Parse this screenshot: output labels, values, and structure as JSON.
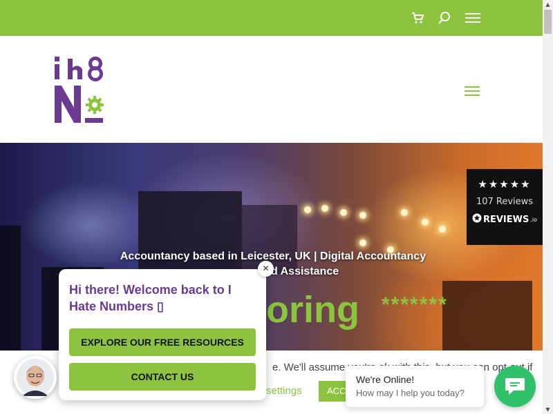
{
  "topbar": {
    "icons": [
      "cart-icon",
      "search-icon",
      "menu-icon"
    ]
  },
  "colors": {
    "brand_green": "#8cc440",
    "brand_purple": "#6b3a92",
    "chat_green": "#2fc26b"
  },
  "logo": {
    "line1": "i h8",
    "line2": "N"
  },
  "hero": {
    "tagline": "Accountancy based in Leicester, UK | Digital Accountancy",
    "tagline2_partial": "d Assistance",
    "headline_partial": "oring",
    "stars": "*******"
  },
  "reviews_badge": {
    "stars": "★★★★★",
    "count_label": "107 Reviews",
    "brand": "REVIEWS",
    "brand_suffix": ".io"
  },
  "cookie_bar": {
    "text_partial": "e. We'll assume you're ok with this, but you can opt-out if",
    "settings_label": "settings",
    "accept_label": "ACCEPT"
  },
  "welcome_popup": {
    "message": "Hi there! Welcome back to I Hate Numbers ",
    "message_glyph": "▯",
    "buttons": {
      "explore": "EXPLORE OUR FREE RESOURCES",
      "contact": "CONTACT US"
    },
    "close_label": "✕"
  },
  "live_chat": {
    "status": "We're Online!",
    "prompt": "How may I help you today?"
  }
}
